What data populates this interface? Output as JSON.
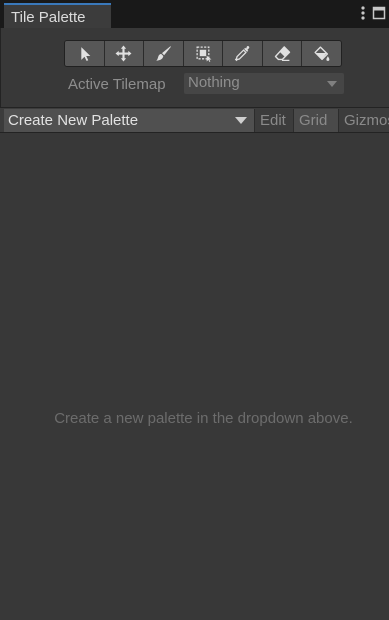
{
  "window": {
    "tab_title": "Tile Palette",
    "menu_icon": "kebab-menu-icon",
    "maximize_icon": "maximize-icon"
  },
  "toolbar": {
    "tools": [
      {
        "name": "select-tool",
        "icon": "arrow-cursor-icon"
      },
      {
        "name": "move-tool",
        "icon": "move-arrows-icon"
      },
      {
        "name": "paint-tool",
        "icon": "brush-icon"
      },
      {
        "name": "box-fill-tool",
        "icon": "box-fill-icon"
      },
      {
        "name": "pick-tool",
        "icon": "eyedropper-icon"
      },
      {
        "name": "erase-tool",
        "icon": "eraser-icon"
      },
      {
        "name": "fill-tool",
        "icon": "paint-bucket-icon"
      }
    ]
  },
  "tilemap": {
    "label": "Active Tilemap",
    "value": "Nothing"
  },
  "palette": {
    "dropdown_value": "Create New Palette",
    "edit_label": "Edit",
    "grid_label": "Grid",
    "gizmos_label": "Gizmos"
  },
  "main": {
    "empty_message": "Create a new palette in the dropdown above."
  },
  "colors": {
    "background": "#383838",
    "tab_accent": "#3a79bb",
    "tool_button": "#575757"
  }
}
